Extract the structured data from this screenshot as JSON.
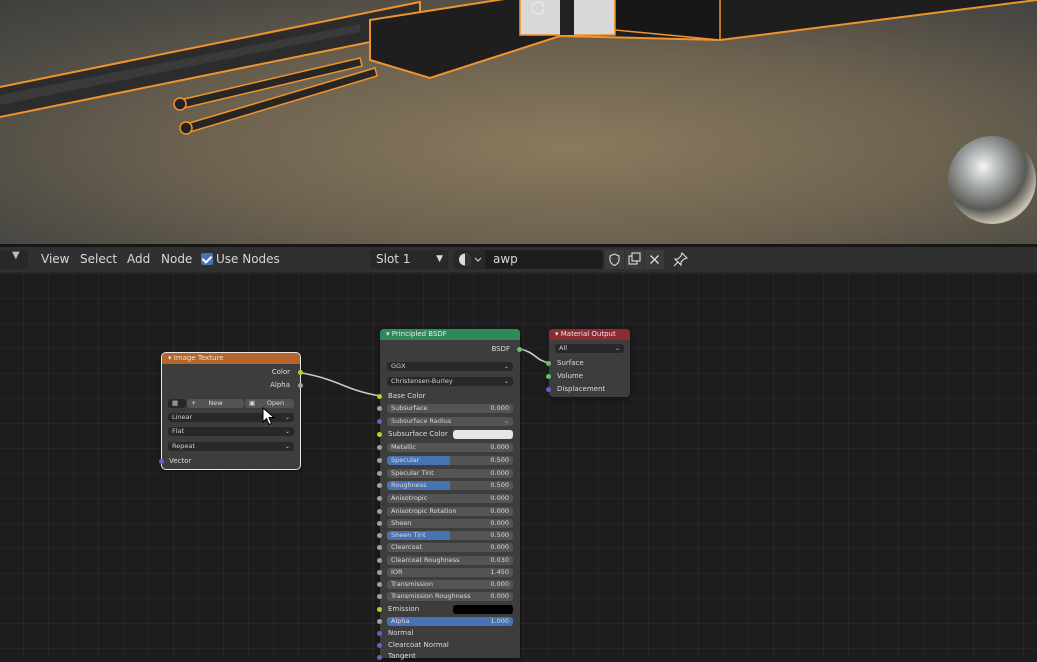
{
  "header": {
    "menu": [
      "View",
      "Select",
      "Add",
      "Node"
    ],
    "use_nodes_label": "Use Nodes",
    "slot_label": "Slot 1",
    "material_name": "awp"
  },
  "nodes": {
    "image_texture": {
      "title": "Image Texture",
      "outputs": [
        "Color",
        "Alpha"
      ],
      "new_label": "New",
      "open_label": "Open",
      "dropdowns": [
        "Linear",
        "Flat",
        "Repeat"
      ],
      "input_vector": "Vector"
    },
    "principled": {
      "title": "Principled BSDF",
      "output": "BSDF",
      "distribution": "GGX",
      "subsurface_method": "Christensen-Burley",
      "base_color_label": "Base Color",
      "subsurface": {
        "label": "Subsurface",
        "value": "0.000"
      },
      "subsurface_radius": "Subsurface Radius",
      "subsurface_color": "Subsurface Color",
      "fields": [
        {
          "label": "Metallic",
          "value": "0.000",
          "fill": 0
        },
        {
          "label": "Specular",
          "value": "0.500",
          "fill": 0.5
        },
        {
          "label": "Specular Tint",
          "value": "0.000",
          "fill": 0
        },
        {
          "label": "Roughness",
          "value": "0.500",
          "fill": 0.5
        },
        {
          "label": "Anisotropic",
          "value": "0.000",
          "fill": 0
        },
        {
          "label": "Anisotropic Rotation",
          "value": "0.000",
          "fill": 0
        },
        {
          "label": "Sheen",
          "value": "0.000",
          "fill": 0
        },
        {
          "label": "Sheen Tint",
          "value": "0.500",
          "fill": 0.5
        },
        {
          "label": "Clearcoat",
          "value": "0.000",
          "fill": 0
        },
        {
          "label": "Clearcoat Roughness",
          "value": "0.030",
          "fill": 0.03
        },
        {
          "label": "IOR",
          "value": "1.450",
          "fill": 0
        },
        {
          "label": "Transmission",
          "value": "0.000",
          "fill": 0
        },
        {
          "label": "Transmission Roughness",
          "value": "0.000",
          "fill": 0
        }
      ],
      "emission_label": "Emission",
      "alpha": {
        "label": "Alpha",
        "value": "1.000",
        "fill": 1
      },
      "normal_label": "Normal",
      "clearcoat_normal_label": "Clearcoat Normal",
      "tangent_label": "Tangent"
    },
    "material_output": {
      "title": "Material Output",
      "target": "All",
      "inputs": [
        "Surface",
        "Volume",
        "Displacement"
      ]
    }
  },
  "colors": {
    "image_header": "#b3652a",
    "principled_header": "#2f8a5a",
    "output_header": "#8e2a33",
    "accent": "#4772b3",
    "selection": "#f0932c"
  }
}
